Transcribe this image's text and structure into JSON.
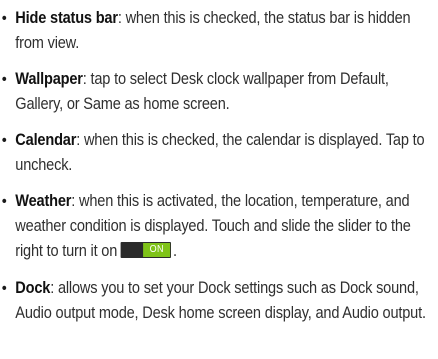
{
  "items": [
    {
      "term": "Hide status bar",
      "text": ": when this is checked, the status bar is hidden from view."
    },
    {
      "term": "Wallpaper",
      "text": ": tap to select Desk clock wallpaper from Default, Gallery, or Same as home screen."
    },
    {
      "term": "Calendar",
      "text": ": when this is checked, the calendar is displayed. Tap to uncheck."
    },
    {
      "term": "Weather",
      "text": ": when this is activated, the location, temperature, and weather condition is displayed. Touch and slide the slider to the right to turn it on",
      "toggle_label": "ON",
      "after_toggle": "."
    },
    {
      "term": "Dock",
      "text": ": allows you to set your Dock settings such as Dock sound, Audio output mode, Desk home screen display, and Audio output."
    }
  ],
  "colors": {
    "toggle_on": "#7fc318",
    "toggle_track": "#2b2b2b"
  }
}
